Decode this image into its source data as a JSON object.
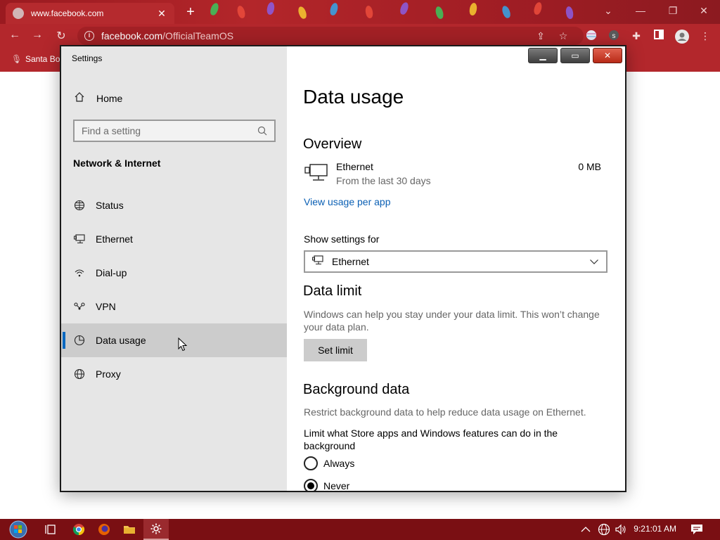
{
  "browser": {
    "tab_title": "www.facebook.com",
    "tab_close": "✕",
    "new_tab": "+",
    "url_host": "facebook.com",
    "url_path": "/OfficialTeamOS",
    "bookmark_label": "Santa Bo"
  },
  "settings": {
    "window_title": "Settings",
    "home_label": "Home",
    "search_placeholder": "Find a setting",
    "section_heading": "Network & Internet",
    "nav_items": [
      {
        "label": "Status",
        "icon": "status-icon"
      },
      {
        "label": "Ethernet",
        "icon": "ethernet-icon"
      },
      {
        "label": "Dial-up",
        "icon": "dialup-icon"
      },
      {
        "label": "VPN",
        "icon": "vpn-icon"
      },
      {
        "label": "Data usage",
        "icon": "data-usage-icon",
        "active": true
      },
      {
        "label": "Proxy",
        "icon": "proxy-icon"
      }
    ],
    "page_title": "Data usage",
    "overview": {
      "heading": "Overview",
      "connection_name": "Ethernet",
      "connection_sub": "From the last 30 days",
      "amount": "0 MB",
      "link": "View usage per app"
    },
    "show_settings_for": {
      "label": "Show settings for",
      "value": "Ethernet"
    },
    "data_limit": {
      "heading": "Data limit",
      "description": "Windows can help you stay under your data limit. This won’t change your data plan.",
      "button": "Set limit"
    },
    "background_data": {
      "heading": "Background data",
      "description": "Restrict background data to help reduce data usage on Ethernet.",
      "question": "Limit what Store apps and Windows features can do in the background",
      "options": [
        {
          "label": "Always",
          "selected": false
        },
        {
          "label": "Never",
          "selected": true
        }
      ]
    }
  },
  "taskbar": {
    "clock": "9:21:01 AM"
  },
  "colors": {
    "accent": "#0067c0",
    "link": "#0a5fb4",
    "chrome_red": "#b3272c",
    "taskbar": "#7a0f13"
  }
}
